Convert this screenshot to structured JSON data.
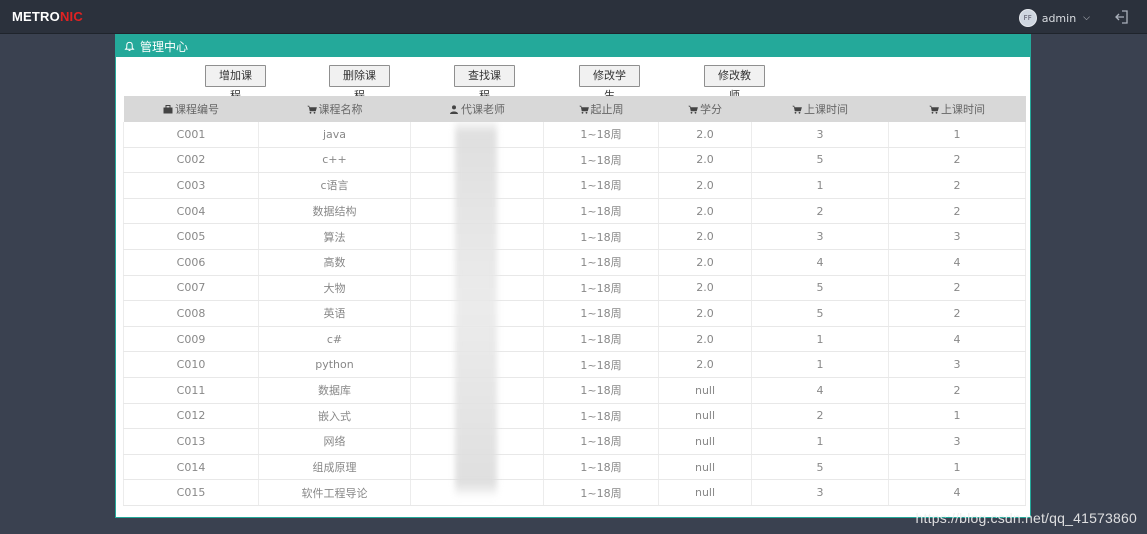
{
  "brand": {
    "part1": "METRO",
    "part2": "NIC"
  },
  "user": {
    "name": "admin",
    "avatar_text": "FF"
  },
  "panel": {
    "title": "管理中心"
  },
  "toolbar": {
    "buttons": [
      "增加课程",
      "删除课程",
      "查找课程",
      "修改学生",
      "修改教师"
    ]
  },
  "table": {
    "headers": [
      "课程编号",
      "课程名称",
      "代课老师",
      "起止周",
      "学分",
      "上课时间",
      "上课时间"
    ],
    "rows": [
      [
        "C001",
        "java",
        "",
        "1~18周",
        "2.0",
        "3",
        "1"
      ],
      [
        "C002",
        "c++",
        "",
        "1~18周",
        "2.0",
        "5",
        "2"
      ],
      [
        "C003",
        "c语言",
        "",
        "1~18周",
        "2.0",
        "1",
        "2"
      ],
      [
        "C004",
        "数据结构",
        "",
        "1~18周",
        "2.0",
        "2",
        "2"
      ],
      [
        "C005",
        "算法",
        "",
        "1~18周",
        "2.0",
        "3",
        "3"
      ],
      [
        "C006",
        "高数",
        "",
        "1~18周",
        "2.0",
        "4",
        "4"
      ],
      [
        "C007",
        "大物",
        "",
        "1~18周",
        "2.0",
        "5",
        "2"
      ],
      [
        "C008",
        "英语",
        "",
        "1~18周",
        "2.0",
        "5",
        "2"
      ],
      [
        "C009",
        "c#",
        "",
        "1~18周",
        "2.0",
        "1",
        "4"
      ],
      [
        "C010",
        "python",
        "",
        "1~18周",
        "2.0",
        "1",
        "3"
      ],
      [
        "C011",
        "数据库",
        "",
        "1~18周",
        "null",
        "4",
        "2"
      ],
      [
        "C012",
        "嵌入式",
        "",
        "1~18周",
        "null",
        "2",
        "1"
      ],
      [
        "C013",
        "网络",
        "",
        "1~18周",
        "null",
        "1",
        "3"
      ],
      [
        "C014",
        "组成原理",
        "",
        "1~18周",
        "null",
        "5",
        "1"
      ],
      [
        "C015",
        "软件工程导论",
        "",
        "1~18周",
        "null",
        "3",
        "4"
      ]
    ]
  },
  "watermark": "https://blog.csdn.net/qq_41573860",
  "colors": {
    "accent": "#24a99a",
    "topbar": "#2b313c",
    "brand_red": "#e02222"
  }
}
